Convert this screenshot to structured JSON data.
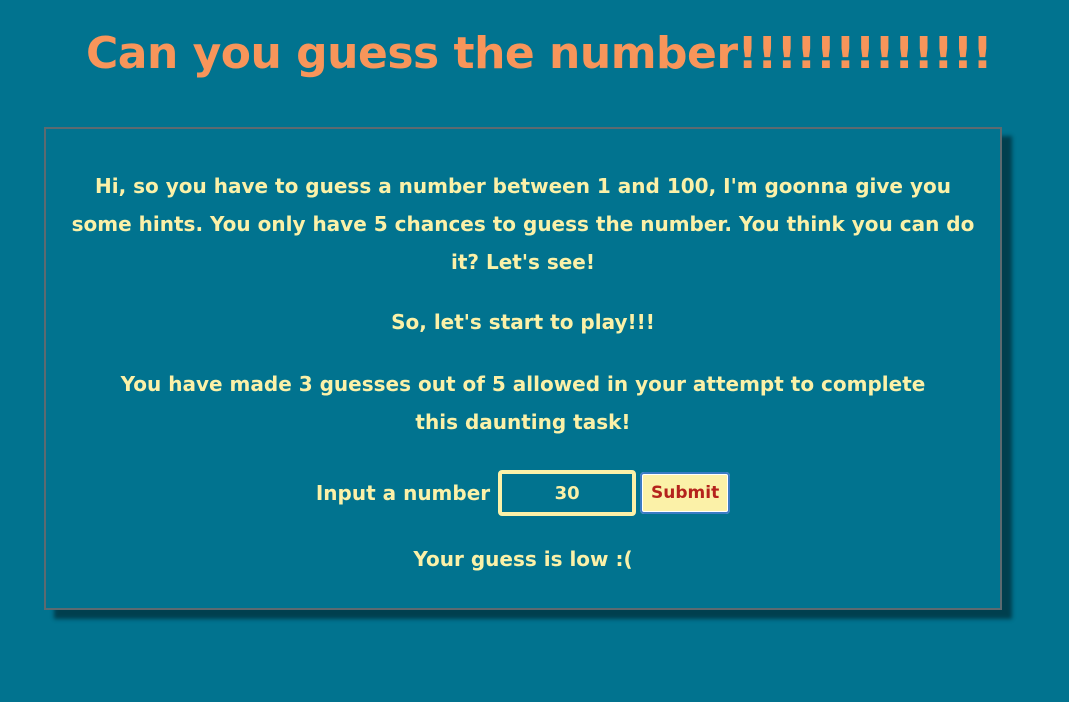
{
  "header": {
    "title": "Can you guess the number!!!!!!!!!!!!!"
  },
  "game": {
    "intro": "Hi, so you have to guess a number between 1 and 100, I'm goonna give you some hints. You only have 5 chances to guess the number. You think you can do it? Let's see!",
    "start_text": "So, let's start to play!!!",
    "guess_status": "You have made 3 guesses out of 5 allowed in your attempt to complete this daunting task!",
    "input_label": "Input a number",
    "input_value": "30",
    "submit_label": "Submit",
    "result": "Your guess is low :("
  },
  "colors": {
    "background": "#01738f",
    "title": "#f8955a",
    "text": "#fbf1a8",
    "submit_text": "#b5231c"
  }
}
